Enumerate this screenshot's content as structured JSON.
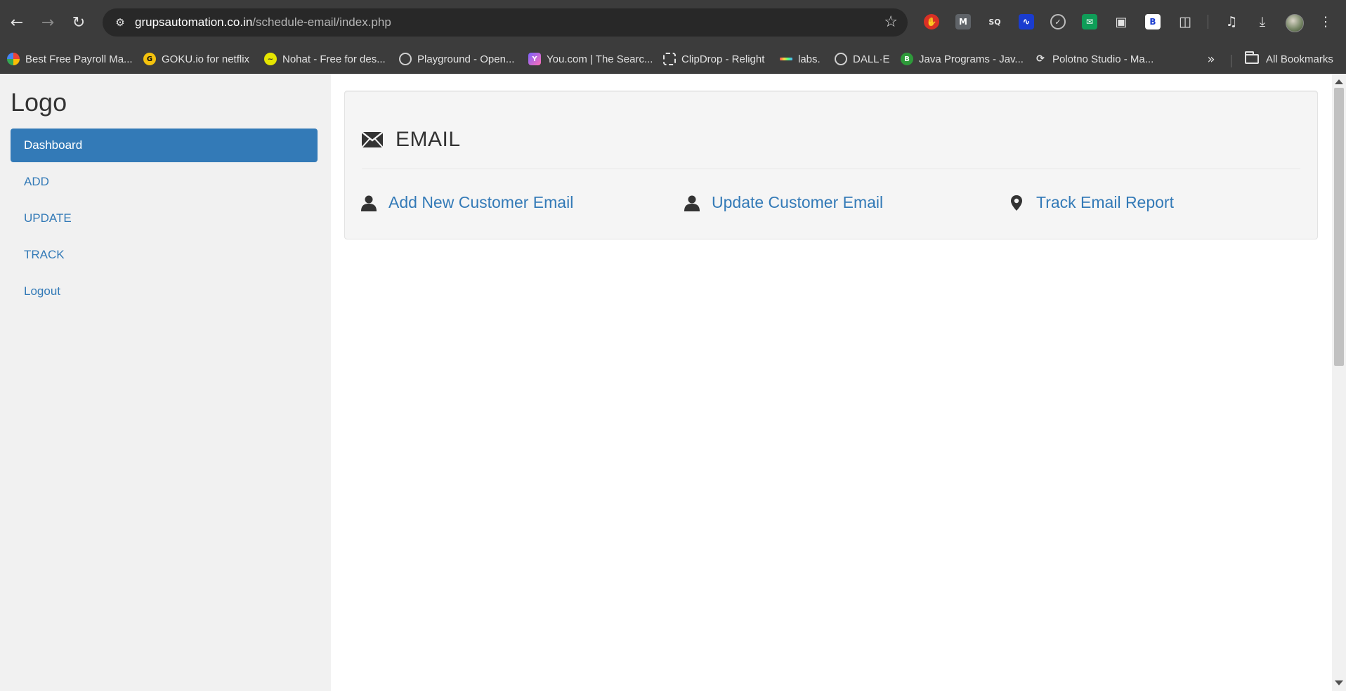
{
  "browser": {
    "url_host": "grupsautomation.co.in",
    "url_path": "/schedule-email/index.php",
    "bookmarks": [
      {
        "label": "Best Free Payroll Ma...",
        "icon": "payroll-favicon"
      },
      {
        "label": "GOKU.io for netflix",
        "icon": "goku-favicon"
      },
      {
        "label": "Nohat - Free for des...",
        "icon": "nohat-favicon"
      },
      {
        "label": "Playground - Open...",
        "icon": "openai-favicon"
      },
      {
        "label": "You.com | The Searc...",
        "icon": "youcom-favicon"
      },
      {
        "label": "ClipDrop - Relight",
        "icon": "clipdrop-favicon"
      },
      {
        "label": "labs.",
        "icon": "labs-favicon"
      },
      {
        "label": "DALL·E",
        "icon": "openai-favicon"
      },
      {
        "label": "Java Programs - Jav...",
        "icon": "java-favicon"
      },
      {
        "label": "Polotno Studio - Ma...",
        "icon": "polotno-favicon"
      }
    ],
    "all_bookmarks_label": "All Bookmarks",
    "extensions": [
      {
        "name": "hand-block-extension",
        "glyph": "✋",
        "color": "#d93025"
      },
      {
        "name": "m-extension",
        "glyph": "M",
        "color": "#5f6368"
      },
      {
        "name": "sq-extension",
        "glyph": "SQ",
        "color": "#3c3c3c"
      },
      {
        "name": "wave-extension",
        "glyph": "〰",
        "color": "#1a3ccf"
      },
      {
        "name": "check-extension",
        "glyph": "✓",
        "color": "#3c3c3c"
      },
      {
        "name": "mail-extension",
        "glyph": "✉",
        "color": "#0f9d58"
      },
      {
        "name": "window-extension",
        "glyph": "▣",
        "color": "#3c3c3c"
      },
      {
        "name": "b-extension",
        "glyph": "B",
        "color": "#ffffff"
      }
    ]
  },
  "sidebar": {
    "logo": "Logo",
    "items": [
      {
        "label": "Dashboard",
        "active": true
      },
      {
        "label": "ADD",
        "active": false
      },
      {
        "label": "UPDATE",
        "active": false
      },
      {
        "label": "TRACK",
        "active": false
      },
      {
        "label": "Logout",
        "active": false
      }
    ]
  },
  "main": {
    "title": "EMAIL",
    "actions": [
      {
        "label": "Add New Customer Email",
        "icon": "user-icon"
      },
      {
        "label": "Update Customer Email",
        "icon": "user-icon"
      },
      {
        "label": "Track Email Report",
        "icon": "map-marker-icon"
      }
    ]
  },
  "colors": {
    "brand": "#337ab7",
    "chrome": "#3c3c3c",
    "sidebar_bg": "#f1f1f1"
  }
}
